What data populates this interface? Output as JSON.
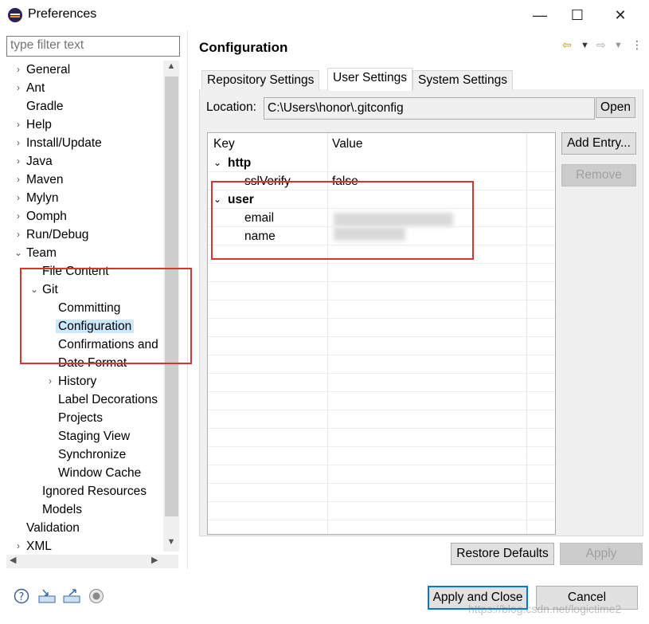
{
  "window": {
    "title": "Preferences",
    "minimize": "—",
    "maximize": "☐",
    "close": "✕"
  },
  "filter": {
    "placeholder": "type filter text"
  },
  "tree": [
    {
      "label": "General",
      "chev": "›"
    },
    {
      "label": "Ant",
      "chev": "›"
    },
    {
      "label": "Gradle",
      "chev": ""
    },
    {
      "label": "Help",
      "chev": "›"
    },
    {
      "label": "Install/Update",
      "chev": "›"
    },
    {
      "label": "Java",
      "chev": "›"
    },
    {
      "label": "Maven",
      "chev": "›"
    },
    {
      "label": "Mylyn",
      "chev": "›"
    },
    {
      "label": "Oomph",
      "chev": "›"
    },
    {
      "label": "Run/Debug",
      "chev": "›"
    },
    {
      "label": "Team",
      "chev": "⌄"
    },
    {
      "label": "File Content",
      "chev": ""
    },
    {
      "label": "Git",
      "chev": "⌄"
    },
    {
      "label": "Committing",
      "chev": ""
    },
    {
      "label": "Configuration",
      "chev": "",
      "selected": true
    },
    {
      "label": "Confirmations and",
      "chev": ""
    },
    {
      "label": "Date Format",
      "chev": ""
    },
    {
      "label": "History",
      "chev": "›"
    },
    {
      "label": "Label Decorations",
      "chev": ""
    },
    {
      "label": "Projects",
      "chev": ""
    },
    {
      "label": "Staging View",
      "chev": ""
    },
    {
      "label": "Synchronize",
      "chev": ""
    },
    {
      "label": "Window Cache",
      "chev": ""
    },
    {
      "label": "Ignored Resources",
      "chev": ""
    },
    {
      "label": "Models",
      "chev": ""
    },
    {
      "label": "Validation",
      "chev": ""
    },
    {
      "label": "XML",
      "chev": "›"
    }
  ],
  "page": {
    "title": "Configuration"
  },
  "tabs": [
    "Repository Settings",
    "User Settings",
    "System Settings"
  ],
  "location": {
    "label": "Location:",
    "value": "C:\\Users\\honor\\.gitconfig",
    "open": "Open"
  },
  "table": {
    "headers": [
      "Key",
      "Value"
    ],
    "rows": [
      {
        "key": "http",
        "value": "",
        "group": true
      },
      {
        "key": "sslVerify",
        "value": "false",
        "group": false
      },
      {
        "key": "user",
        "value": "",
        "group": true
      },
      {
        "key": "email",
        "value": "",
        "group": false
      },
      {
        "key": "name",
        "value": "",
        "group": false
      }
    ]
  },
  "side_buttons": {
    "add": "Add Entry...",
    "remove": "Remove"
  },
  "footer": {
    "restore": "Restore Defaults",
    "apply": "Apply",
    "apply_close": "Apply and Close",
    "cancel": "Cancel"
  },
  "bottom_icons": [
    "help-icon",
    "import-icon",
    "export-icon",
    "record-icon"
  ],
  "watermark": "https://blog.csdn.net/logictime2",
  "colors": {
    "selection": "#cce8ff",
    "annotation": "#e03030",
    "primary_border": "#0078d7"
  }
}
